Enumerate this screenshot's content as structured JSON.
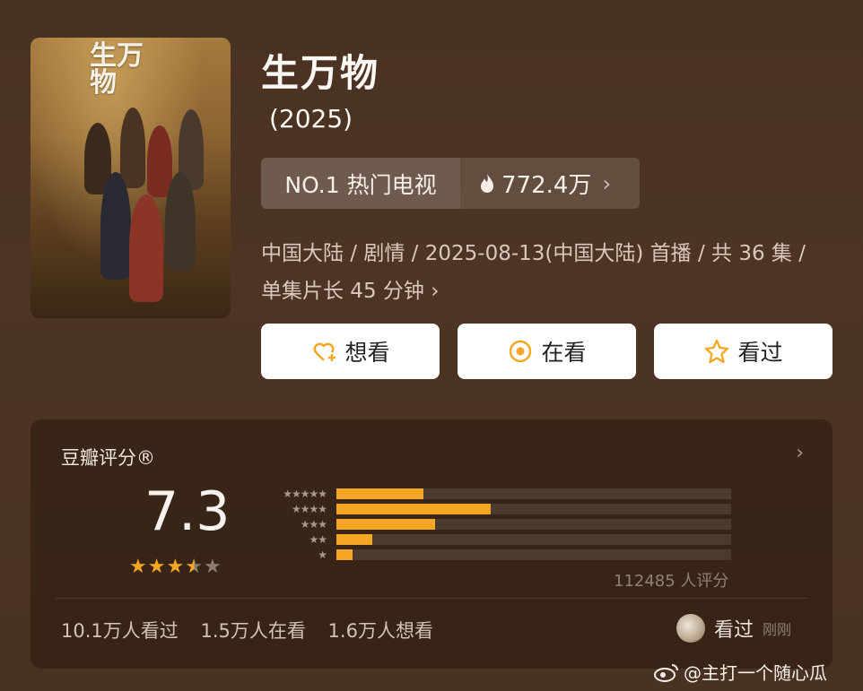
{
  "poster": {
    "title_text": "生万物"
  },
  "show": {
    "title": "生万物",
    "year": "(2025)",
    "rank_label": "NO.1 热门电视",
    "heat": "772.4万",
    "meta_line1": "中国大陆 / 剧情 / 2025-08-13(中国大陆) 首播 / 共 36 集 /",
    "meta_line2": "单集片长 45 分钟"
  },
  "buttons": {
    "want": "想看",
    "watching": "在看",
    "watched": "看过"
  },
  "rating": {
    "title": "豆瓣评分®",
    "score": "7.3",
    "stars_filled": 3.5,
    "count": "112485 人评分",
    "distribution": [
      {
        "stars": "★★★★★",
        "percent": 22
      },
      {
        "stars": "★★★★",
        "percent": 39
      },
      {
        "stars": "★★★",
        "percent": 25
      },
      {
        "stars": "★★",
        "percent": 9
      },
      {
        "stars": "★",
        "percent": 4
      }
    ]
  },
  "stats": {
    "watched": "10.1万人看过",
    "watching": "1.5万人在看",
    "want": "1.6万人想看"
  },
  "my_status": {
    "label": "看过",
    "time": "刚刚"
  },
  "watermark": {
    "text": "@主打一个随心瓜"
  },
  "colors": {
    "accent": "#f5a623",
    "background": "#4a3222"
  }
}
